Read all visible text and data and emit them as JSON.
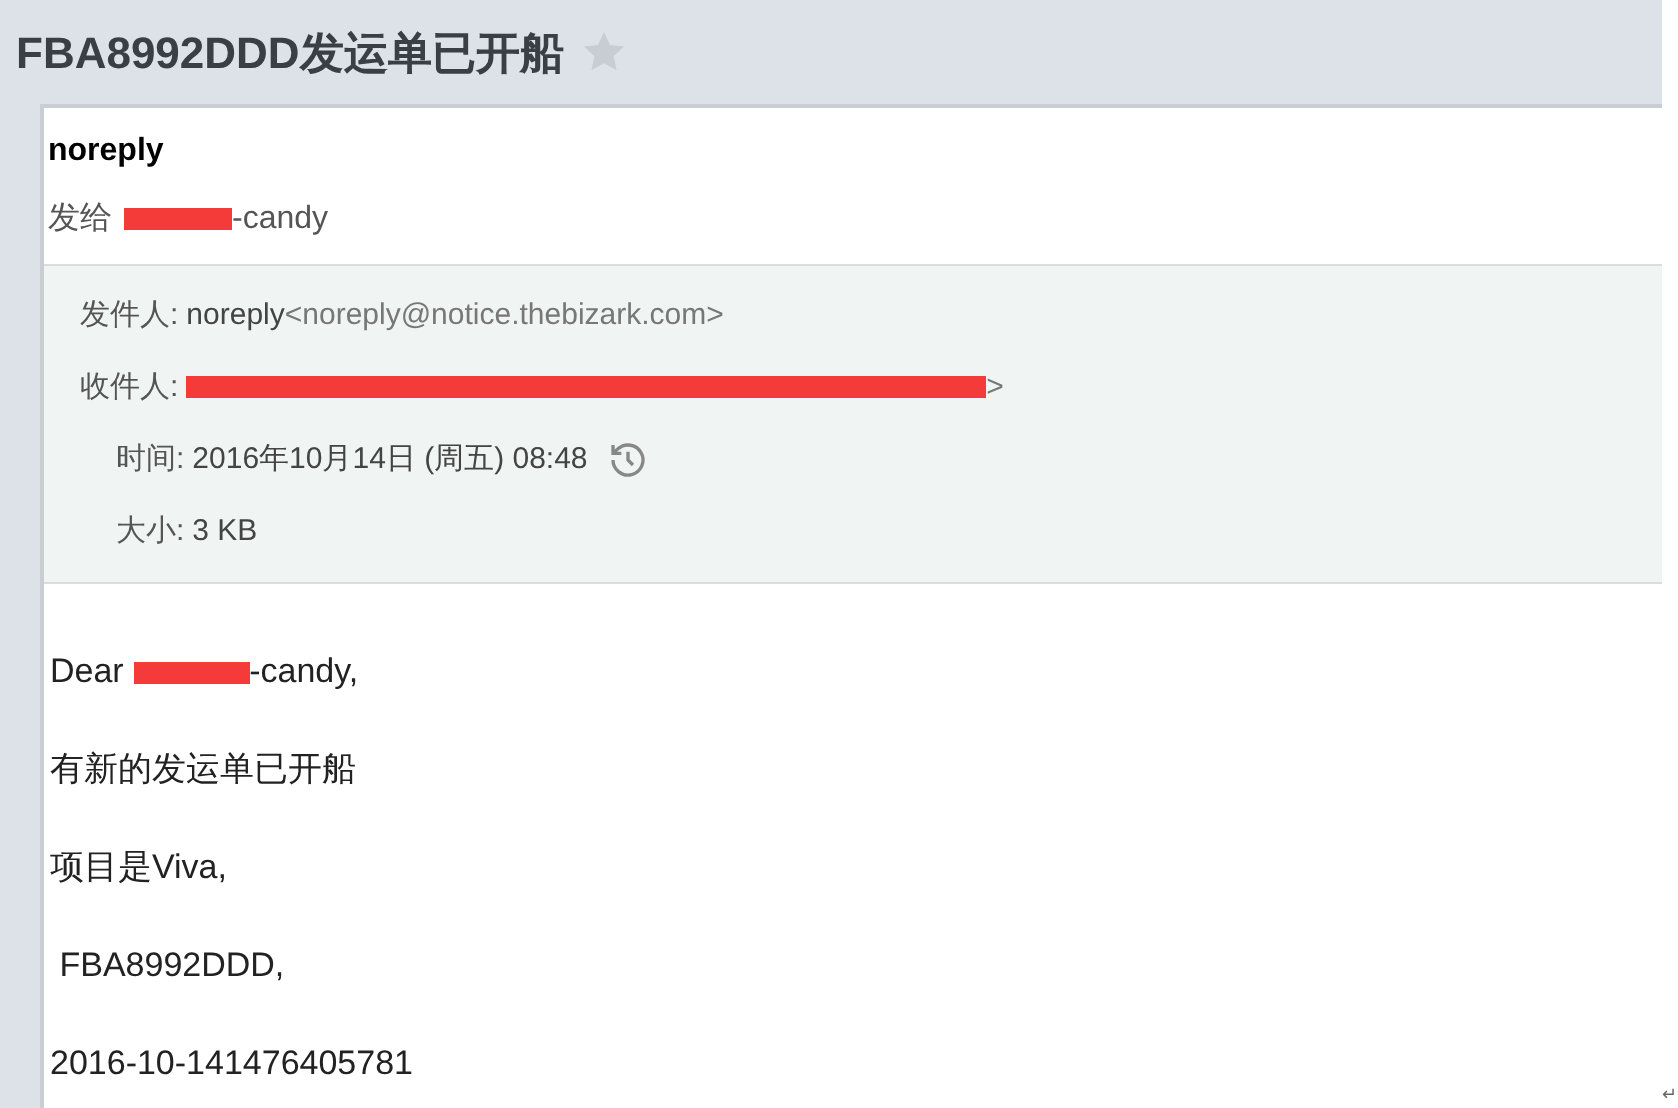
{
  "subject": {
    "title": "FBA8992DDD发运单已开船",
    "starred": false
  },
  "message": {
    "sender": "noreply",
    "to_prefix": "发给",
    "to_suffix": "-candy",
    "details": [
      {
        "kind": "from",
        "label": "发件人:",
        "name": "noreply",
        "value": "<noreply@notice.thebizark.com>"
      },
      {
        "kind": "to",
        "label": "收件人:",
        "value": ">"
      },
      {
        "kind": "time",
        "label": "时间:",
        "value": "2016年10月14日 (周五) 08:48"
      },
      {
        "kind": "size",
        "label": "大小:",
        "value": "3 KB"
      }
    ],
    "body": [
      {
        "kind": "greeting",
        "text": "Dear ",
        "after": "-candy,"
      },
      {
        "kind": "line",
        "text": "有新的发运单已开船"
      },
      {
        "kind": "line",
        "text": "项目是Viva,"
      },
      {
        "kind": "line",
        "text": " FBA8992DDD,"
      },
      {
        "kind": "line",
        "text": "2016-10-141476405781"
      }
    ]
  },
  "corner_mark": "↵"
}
